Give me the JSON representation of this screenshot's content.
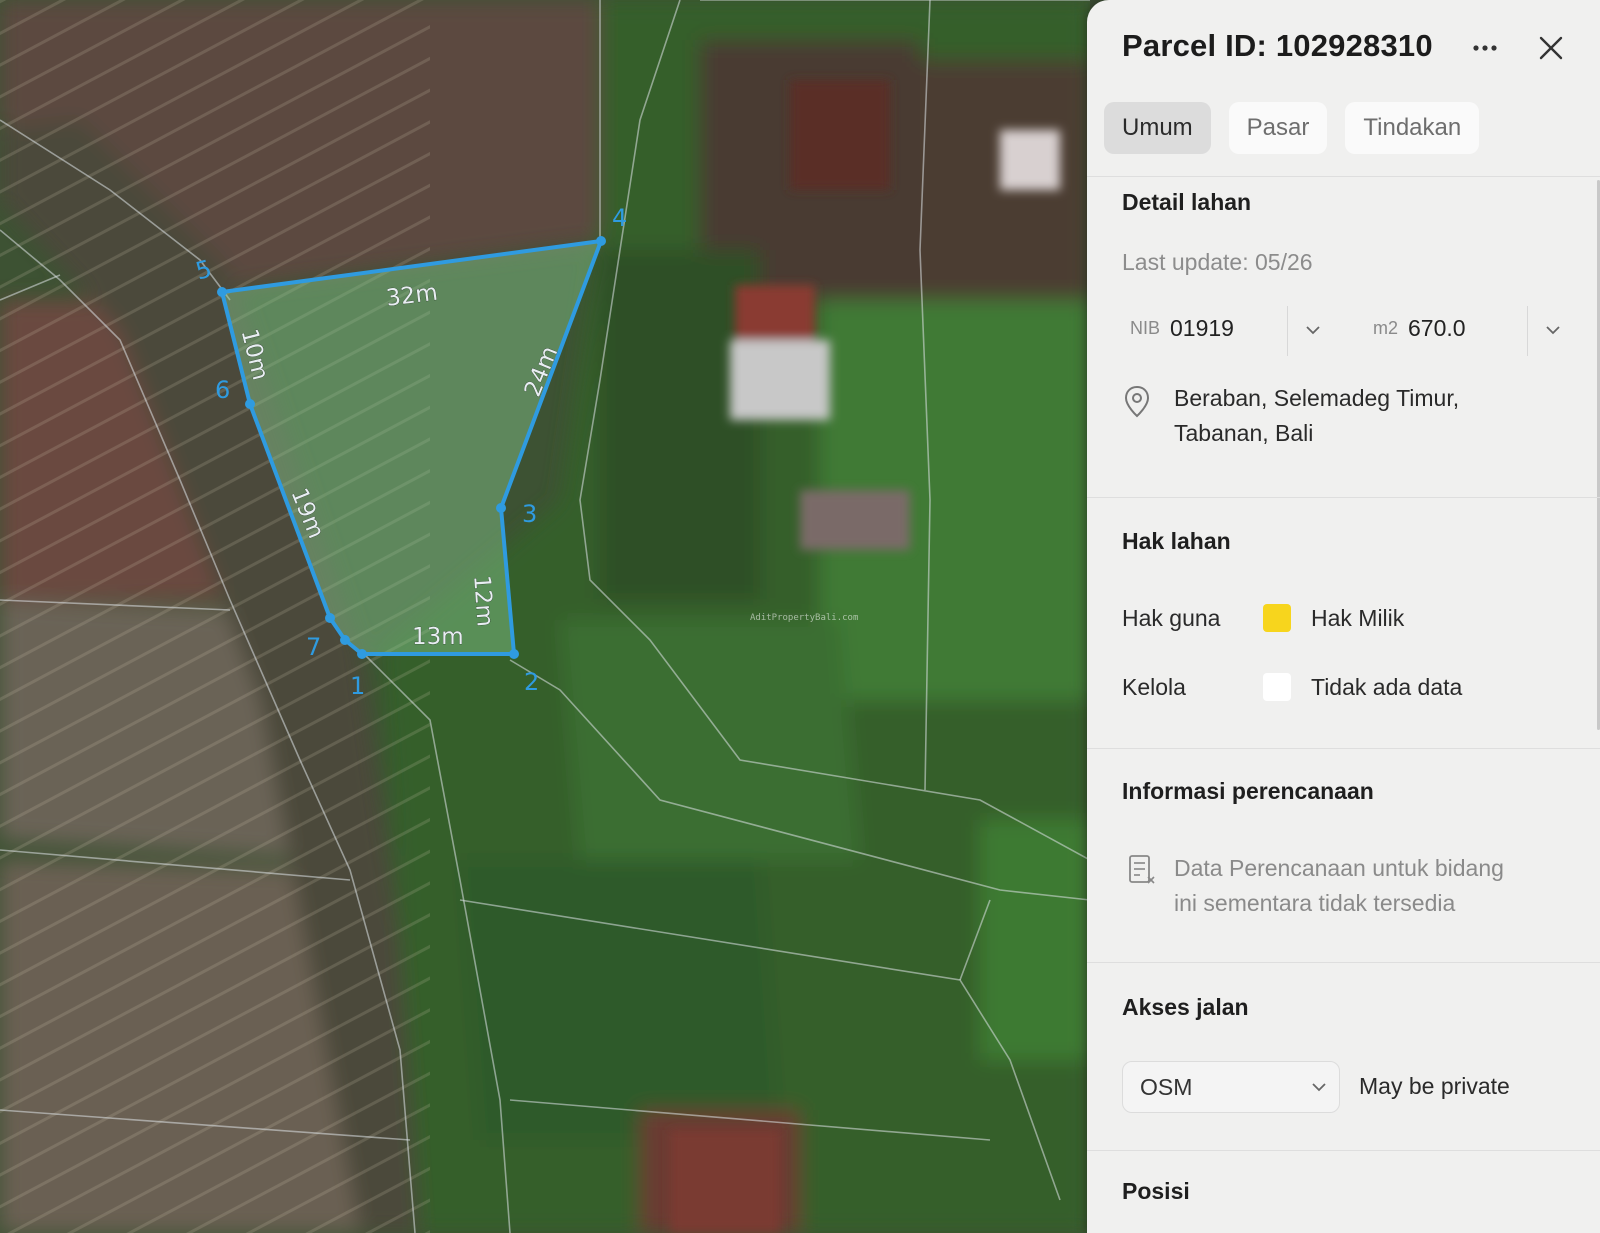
{
  "map": {
    "vertex_labels": [
      "1",
      "2",
      "3",
      "4",
      "5",
      "6",
      "7"
    ],
    "measurements": [
      "32m",
      "24m",
      "12m",
      "13m",
      "19m",
      "10m"
    ],
    "watermark": "AditPropertyBali.com",
    "parcel_color": "#2f9be0"
  },
  "panel": {
    "title": "Parcel ID: 102928310",
    "tabs": [
      {
        "label": "Umum",
        "active": true
      },
      {
        "label": "Pasar",
        "active": false
      },
      {
        "label": "Tindakan",
        "active": false
      }
    ],
    "detail": {
      "heading": "Detail lahan",
      "last_update": "Last update: 05/26",
      "nib_label": "NIB",
      "nib_value": "01919",
      "area_label": "m2",
      "area_value": "670.0",
      "location_line1": "Beraban, Selemadeg Timur,",
      "location_line2": "Tabanan, Bali"
    },
    "rights": {
      "heading": "Hak lahan",
      "rows": [
        {
          "label": "Hak guna",
          "value": "Hak Milik",
          "color": "#f7d51d"
        },
        {
          "label": "Kelola",
          "value": "Tidak ada data",
          "color": "#ffffff"
        }
      ]
    },
    "planning": {
      "heading": "Informasi perencanaan",
      "message_line1": "Data Perencanaan untuk bidang",
      "message_line2": "ini sementara tidak tersedia"
    },
    "access": {
      "heading": "Akses jalan",
      "source": "OSM",
      "note": "May be private"
    },
    "position": {
      "heading": "Posisi"
    }
  }
}
